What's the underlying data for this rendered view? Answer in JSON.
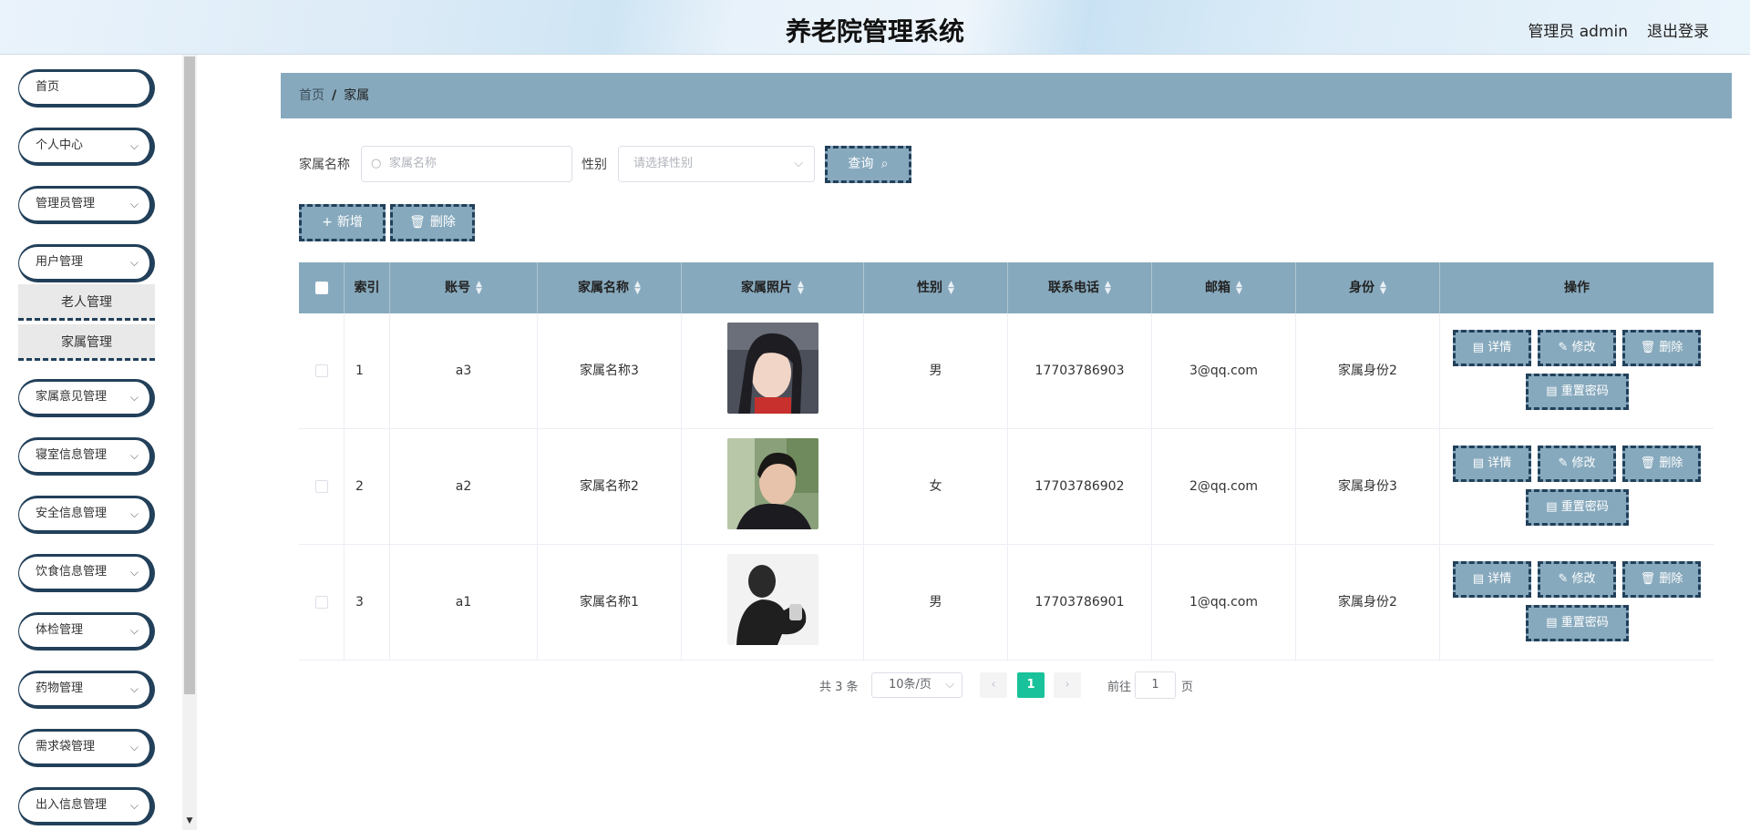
{
  "header": {
    "title": "养老院管理系统",
    "admin": "管理员 admin",
    "logout": "退出登录"
  },
  "sidebar": {
    "items": [
      {
        "label": "首页"
      },
      {
        "label": "个人中心"
      },
      {
        "label": "管理员管理"
      },
      {
        "label": "用户管理"
      },
      {
        "label": "家属意见管理"
      },
      {
        "label": "寝室信息管理"
      },
      {
        "label": "安全信息管理"
      },
      {
        "label": "饮食信息管理"
      },
      {
        "label": "体检管理"
      },
      {
        "label": "药物管理"
      },
      {
        "label": "需求袋管理"
      },
      {
        "label": "出入信息管理"
      }
    ],
    "subitems": [
      {
        "label": "老人管理"
      },
      {
        "label": "家属管理"
      }
    ]
  },
  "breadcrumb": {
    "home": "首页",
    "sep": "/",
    "current": "家属"
  },
  "search": {
    "name_label": "家属名称",
    "name_placeholder": "家属名称",
    "gender_label": "性别",
    "gender_placeholder": "请选择性别",
    "query_button": "查询"
  },
  "toolbar": {
    "add": "新增",
    "delete": "删除"
  },
  "table": {
    "headers": [
      "索引",
      "账号",
      "家属名称",
      "家属照片",
      "性别",
      "联系电话",
      "邮箱",
      "身份",
      "操作"
    ],
    "rows": [
      {
        "index": "1",
        "account": "a3",
        "name": "家属名称3",
        "gender": "男",
        "phone": "17703786903",
        "email": "3@qq.com",
        "identity": "家属身份2"
      },
      {
        "index": "2",
        "account": "a2",
        "name": "家属名称2",
        "gender": "女",
        "phone": "17703786902",
        "email": "2@qq.com",
        "identity": "家属身份3"
      },
      {
        "index": "3",
        "account": "a1",
        "name": "家属名称1",
        "gender": "男",
        "phone": "17703786901",
        "email": "1@qq.com",
        "identity": "家属身份2"
      }
    ],
    "actions": {
      "detail": "详情",
      "edit": "修改",
      "delete": "删除",
      "reset": "重置密码"
    }
  },
  "pager": {
    "total": "共 3 条",
    "page_size": "10条/页",
    "current": "1",
    "goto": "前往",
    "goto_value": "1",
    "page_unit": "页"
  },
  "colors": {
    "accent": "#87a9bd",
    "border": "#22405a",
    "active_page": "#19c29a"
  }
}
